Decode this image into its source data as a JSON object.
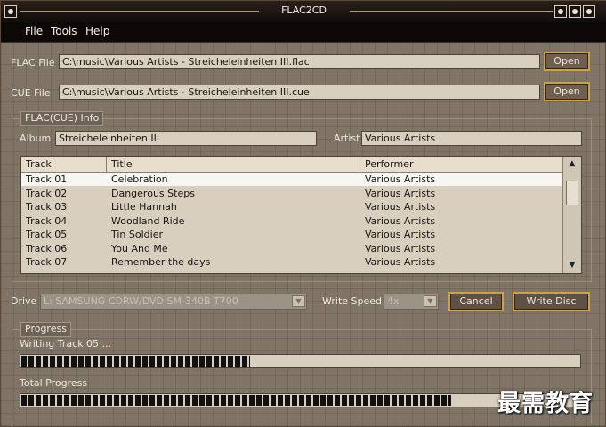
{
  "window": {
    "title": "FLAC2CD"
  },
  "menu": [
    "File",
    "Tools",
    "Help"
  ],
  "flac_file": {
    "label": "FLAC File",
    "value": "C:\\music\\Various Artists - Streicheleinheiten III.flac",
    "button": "Open"
  },
  "cue_file": {
    "label": "CUE File",
    "value": "C:\\music\\Various Artists - Streicheleinheiten III.cue",
    "button": "Open"
  },
  "info": {
    "group_title": "FLAC(CUE) Info",
    "album_label": "Album",
    "album_value": "Streicheleinheiten III",
    "artist_label": "Artist",
    "artist_value": "Various Artists"
  },
  "tracklist": {
    "columns": [
      "Track",
      "Title",
      "Performer"
    ],
    "rows": [
      {
        "track": "Track 01",
        "title": "Celebration",
        "performer": "Various Artists"
      },
      {
        "track": "Track 02",
        "title": "Dangerous Steps",
        "performer": "Various Artists"
      },
      {
        "track": "Track 03",
        "title": "Little Hannah",
        "performer": "Various Artists"
      },
      {
        "track": "Track 04",
        "title": "Woodland Ride",
        "performer": "Various Artists"
      },
      {
        "track": "Track 05",
        "title": "Tin Soldier",
        "performer": "Various Artists"
      },
      {
        "track": "Track 06",
        "title": "You And Me",
        "performer": "Various Artists"
      },
      {
        "track": "Track 07",
        "title": "Remember the days",
        "performer": "Various Artists"
      }
    ],
    "selected_index": 0
  },
  "drive": {
    "label": "Drive",
    "value": "L: SAMSUNG CDRW/DVD SM-340B T700"
  },
  "write_speed": {
    "label": "Write Speed",
    "value": "4x"
  },
  "buttons": {
    "cancel": "Cancel",
    "write_disc": "Write Disc"
  },
  "progress": {
    "group_title": "Progress",
    "status": "Writing Track 05 ...",
    "track_fraction": 0.41,
    "total_label": "Total Progress",
    "total_fraction": 0.77
  },
  "watermark": "最需教育"
}
